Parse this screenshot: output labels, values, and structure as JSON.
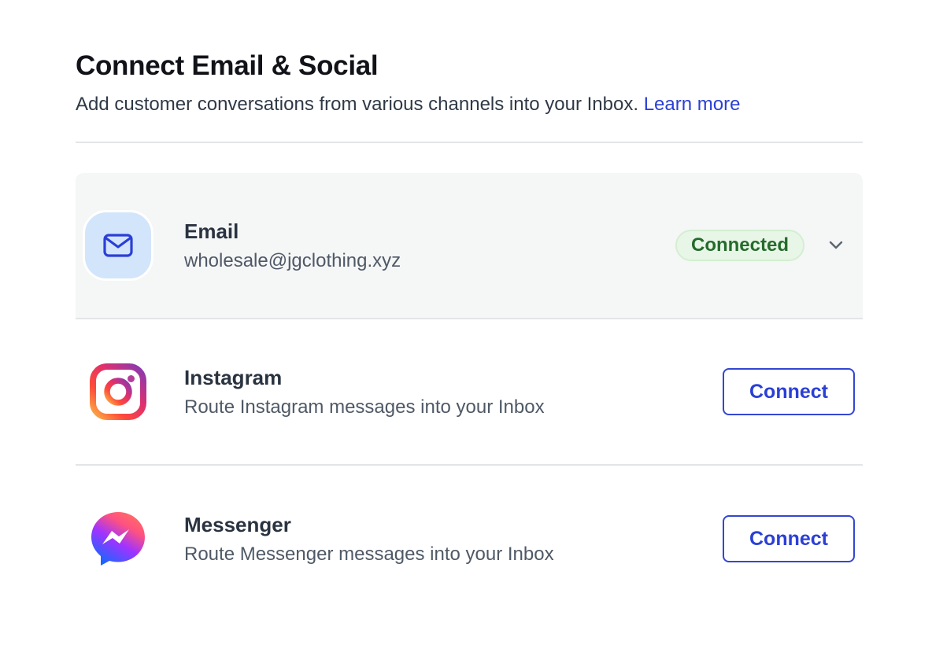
{
  "header": {
    "title": "Connect Email & Social",
    "subtitle": "Add customer conversations from various channels into your Inbox.",
    "learn_more": "Learn more"
  },
  "channels": [
    {
      "name": "Email",
      "description": "wholesale@jgclothing.xyz",
      "icon": "envelope-icon",
      "status": "Connected",
      "status_color": "#256b2c",
      "expand_icon": "chevron-down-icon"
    },
    {
      "name": "Instagram",
      "description": "Route Instagram messages into your Inbox",
      "icon": "instagram-icon",
      "action": "Connect"
    },
    {
      "name": "Messenger",
      "description": "Route Messenger messages into your Inbox",
      "icon": "messenger-icon",
      "action": "Connect"
    }
  ],
  "colors": {
    "accent": "#2b3fd6",
    "connected_bg": "#e8f6e7",
    "email_icon_bg": "#d2e5fb"
  }
}
